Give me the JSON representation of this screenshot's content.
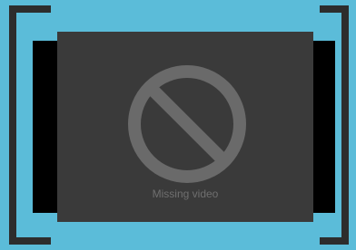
{
  "video": {
    "missing_label": "Missing video",
    "icon": "prohibited-icon"
  },
  "colors": {
    "background": "#5bbcd9",
    "frame_bracket": "#2d2d2d",
    "letterbox": "#000000",
    "panel": "#3a3a3a",
    "icon": "#6a6a6a",
    "label": "#6f6f6f"
  }
}
